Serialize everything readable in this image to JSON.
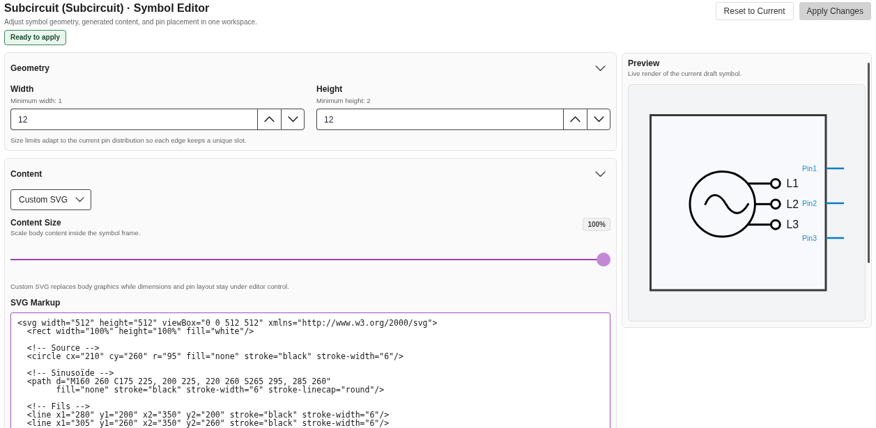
{
  "header": {
    "title": "Subcircuit (Subcircuit) · Symbol Editor",
    "subtitle": "Adjust symbol geometry, generated content, and pin placement in one workspace.",
    "status_badge": "Ready to apply"
  },
  "actions": [
    {
      "label": "Reset to Current",
      "kind": "outline"
    },
    {
      "label": "Apply Changes",
      "kind": "filled"
    }
  ],
  "geometry": {
    "title": "Geometry",
    "expanded": true,
    "fields": [
      {
        "label": "Width",
        "hint": "Minimum width: 1",
        "value": "12"
      },
      {
        "label": "Height",
        "hint": "Minimum height: 2",
        "value": "12"
      }
    ],
    "note": "Size limits adapt to the current pin distribution so each edge keeps a unique slot."
  },
  "content": {
    "title": "Content",
    "expanded": true,
    "mode": "Custom SVG",
    "size": {
      "label": "Content Size",
      "description": "Scale body content inside the symbol frame.",
      "reading": "100%",
      "level": 1
    },
    "note": "Custom SVG replaces body graphics while dimensions and pin layout stay under editor control.",
    "markup": {
      "label": "SVG Markup",
      "value": "<svg width=\"512\" height=\"512\" viewBox=\"0 0 512 512\" xmlns=\"http://www.w3.org/2000/svg\">\n  <rect width=\"100%\" height=\"100%\" fill=\"white\"/>\n\n  <!-- Source -->\n  <circle cx=\"210\" cy=\"260\" r=\"95\" fill=\"none\" stroke=\"black\" stroke-width=\"6\"/>\n\n  <!-- Sinusoïde -->\n  <path d=\"M160 260 C175 225, 200 225, 220 260 S265 295, 285 260\"\n        fill=\"none\" stroke=\"black\" stroke-width=\"6\" stroke-linecap=\"round\"/>\n\n  <!-- Fils -->\n  <line x1=\"280\" y1=\"200\" x2=\"350\" y2=\"200\" stroke=\"black\" stroke-width=\"6\"/>\n  <line x1=\"305\" y1=\"260\" x2=\"350\" y2=\"260\" stroke=\"black\" stroke-width=\"6\"/>"
    }
  },
  "preview": {
    "title": "Preview",
    "description": "Live render of the current draft symbol.",
    "terminals": [
      {
        "label": "L1"
      },
      {
        "label": "L2"
      },
      {
        "label": "L3"
      }
    ],
    "pins": [
      {
        "label": "Pin1"
      },
      {
        "label": "Pin2"
      },
      {
        "label": "Pin3"
      }
    ]
  }
}
